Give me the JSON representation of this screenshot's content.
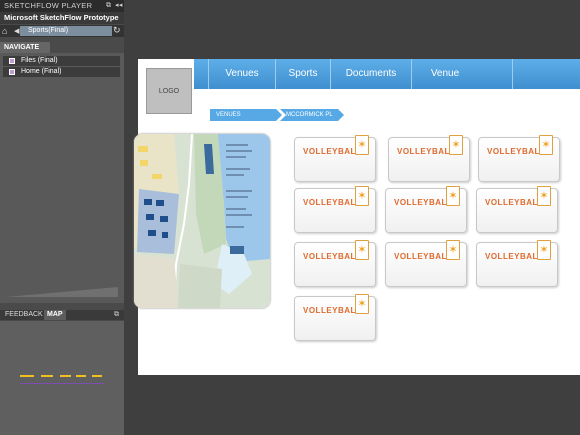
{
  "player": {
    "title": "SKETCHFLOW PLAYER",
    "app_name": "Microsoft SketchFlow Prototype",
    "current_screen": "Sports(Final)",
    "navigate_tab": "NAVIGATE",
    "nav_items": [
      {
        "label": "Files (Final)"
      },
      {
        "label": "Home (Final)"
      }
    ],
    "bottom_tabs": [
      "FEEDBACK",
      "MAP"
    ],
    "icons": [
      "home-icon",
      "back-icon",
      "refresh-icon",
      "popout-icon",
      "collapse-icon"
    ]
  },
  "prototype": {
    "logo": "LOGO",
    "menu": [
      "Venues",
      "Sports",
      "Documents",
      "Venue"
    ],
    "breadcrumbs": [
      "VENUES",
      "MCCORMICK PL"
    ],
    "card_label": "VOLLEYBALL",
    "cards": [
      "VOLLEYBALL",
      "VOLLEYBALL",
      "VOLLEYBALL",
      "VOLLEYBALL",
      "VOLLEYBALL",
      "VOLLEYBALL",
      "VOLLEYBALL",
      "VOLLEYBALL",
      "VOLLEYBALL",
      "VOLLEYBALL"
    ]
  },
  "colors": {
    "accent_blue": "#4a9ee0",
    "card_orange": "#e06a2e",
    "badge_gold": "#f0a020",
    "nav_item_marker": "#bf9bd6"
  }
}
